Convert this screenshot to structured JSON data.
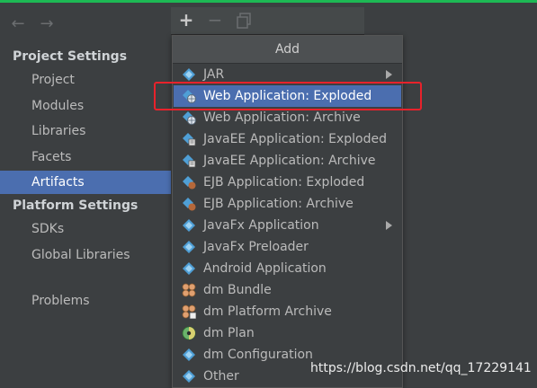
{
  "colors": {
    "accent": "#4b6eaf",
    "background": "#3c3f41",
    "annotation_box": "#e8222b",
    "top_strip": "#1db954"
  },
  "navigation": {
    "back_icon": "arrow-left-icon",
    "forward_icon": "arrow-right-icon"
  },
  "sidebar": {
    "project_settings_title": "Project Settings",
    "project_items": [
      {
        "label": "Project"
      },
      {
        "label": "Modules"
      },
      {
        "label": "Libraries"
      },
      {
        "label": "Facets"
      },
      {
        "label": "Artifacts",
        "selected": true
      }
    ],
    "platform_settings_title": "Platform Settings",
    "platform_items": [
      {
        "label": "SDKs"
      },
      {
        "label": "Global Libraries"
      }
    ],
    "problems_label": "Problems"
  },
  "toolbar": {
    "add_icon": "plus-icon",
    "remove_icon": "minus-icon",
    "copy_icon": "copy-icon"
  },
  "popup": {
    "title": "Add",
    "items": [
      {
        "label": "JAR",
        "icon": "artifact-icon",
        "has_submenu": true
      },
      {
        "label": "Web Application: Exploded",
        "icon": "web-artifact-icon",
        "highlighted": true
      },
      {
        "label": "Web Application: Archive",
        "icon": "web-artifact-icon"
      },
      {
        "label": "JavaEE Application: Exploded",
        "icon": "javaee-artifact-icon"
      },
      {
        "label": "JavaEE Application: Archive",
        "icon": "javaee-artifact-icon"
      },
      {
        "label": "EJB Application: Exploded",
        "icon": "ejb-artifact-icon"
      },
      {
        "label": "EJB Application: Archive",
        "icon": "ejb-artifact-icon"
      },
      {
        "label": "JavaFx Application",
        "icon": "artifact-icon",
        "has_submenu": true
      },
      {
        "label": "JavaFx Preloader",
        "icon": "artifact-icon"
      },
      {
        "label": "Android Application",
        "icon": "artifact-icon"
      },
      {
        "label": "dm Bundle",
        "icon": "dm-bundle-icon"
      },
      {
        "label": "dm Platform Archive",
        "icon": "dm-platform-icon"
      },
      {
        "label": "dm Plan",
        "icon": "dm-plan-icon"
      },
      {
        "label": "dm Configuration",
        "icon": "dm-configuration-icon"
      },
      {
        "label": "Other",
        "icon": "artifact-icon"
      }
    ]
  },
  "watermark": "https://blog.csdn.net/qq_17229141"
}
